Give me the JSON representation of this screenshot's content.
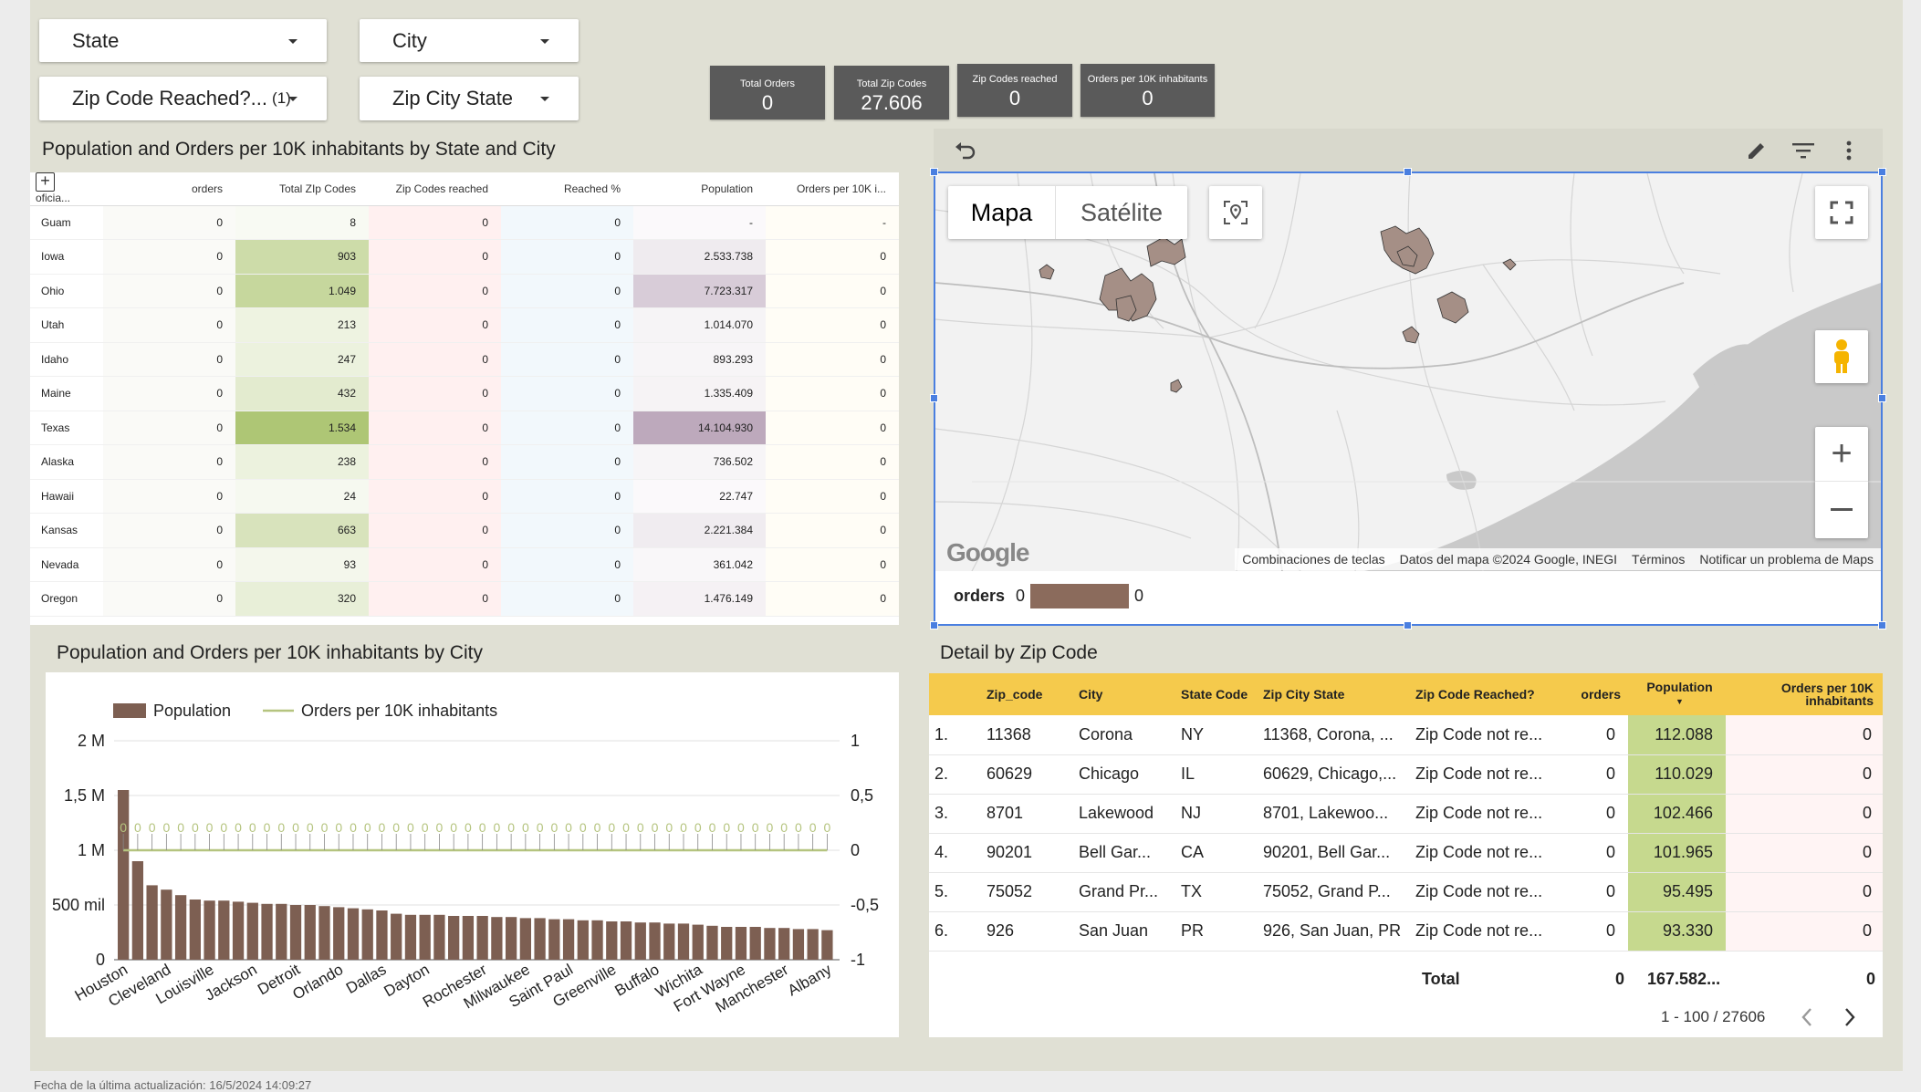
{
  "filters": {
    "state": "State",
    "city": "City",
    "zip_reached": "Zip Code Reached?...",
    "zip_reached_count": "(1)",
    "zip_city_state": "Zip City State"
  },
  "kpis": [
    {
      "label": "Total Orders",
      "value": "0"
    },
    {
      "label": "Total Zip Codes",
      "value": "27.606"
    },
    {
      "label": "Zip Codes reached",
      "value": "0"
    },
    {
      "label": "Orders per 10K inhabitants",
      "value": "0"
    }
  ],
  "state_table": {
    "title": "Population and Orders per 10K inhabitants by State and City",
    "headers": [
      "oficia...",
      "orders",
      "Total ZIp Codes",
      "Zip Codes reached",
      "Reached %",
      "Population",
      "Orders per 10K i..."
    ],
    "rows": [
      {
        "name": "Guam",
        "orders": "0",
        "zips": "8",
        "zips_level": 0.005,
        "reached": "0",
        "pct": "0",
        "pop": "-",
        "pop_level": 0,
        "per10k": "-"
      },
      {
        "name": "Iowa",
        "orders": "0",
        "zips": "903",
        "zips_level": 0.59,
        "reached": "0",
        "pct": "0",
        "pop": "2.533.738",
        "pop_level": 0.18,
        "per10k": "0"
      },
      {
        "name": "Ohio",
        "orders": "0",
        "zips": "1.049",
        "zips_level": 0.68,
        "reached": "0",
        "pct": "0",
        "pop": "7.723.317",
        "pop_level": 0.55,
        "per10k": "0"
      },
      {
        "name": "Utah",
        "orders": "0",
        "zips": "213",
        "zips_level": 0.14,
        "reached": "0",
        "pct": "0",
        "pop": "1.014.070",
        "pop_level": 0.07,
        "per10k": "0"
      },
      {
        "name": "Idaho",
        "orders": "0",
        "zips": "247",
        "zips_level": 0.16,
        "reached": "0",
        "pct": "0",
        "pop": "893.293",
        "pop_level": 0.06,
        "per10k": "0"
      },
      {
        "name": "Maine",
        "orders": "0",
        "zips": "432",
        "zips_level": 0.28,
        "reached": "0",
        "pct": "0",
        "pop": "1.335.409",
        "pop_level": 0.09,
        "per10k": "0"
      },
      {
        "name": "Texas",
        "orders": "0",
        "zips": "1.534",
        "zips_level": 1.0,
        "reached": "0",
        "pct": "0",
        "pop": "14.104.930",
        "pop_level": 1.0,
        "per10k": "0"
      },
      {
        "name": "Alaska",
        "orders": "0",
        "zips": "238",
        "zips_level": 0.16,
        "reached": "0",
        "pct": "0",
        "pop": "736.502",
        "pop_level": 0.05,
        "per10k": "0"
      },
      {
        "name": "Hawaii",
        "orders": "0",
        "zips": "24",
        "zips_level": 0.02,
        "reached": "0",
        "pct": "0",
        "pop": "22.747",
        "pop_level": 0.002,
        "per10k": "0"
      },
      {
        "name": "Kansas",
        "orders": "0",
        "zips": "663",
        "zips_level": 0.43,
        "reached": "0",
        "pct": "0",
        "pop": "2.221.384",
        "pop_level": 0.16,
        "per10k": "0"
      },
      {
        "name": "Nevada",
        "orders": "0",
        "zips": "93",
        "zips_level": 0.06,
        "reached": "0",
        "pct": "0",
        "pop": "361.042",
        "pop_level": 0.03,
        "per10k": "0"
      },
      {
        "name": "Oregon",
        "orders": "0",
        "zips": "320",
        "zips_level": 0.21,
        "reached": "0",
        "pct": "0",
        "pop": "1.476.149",
        "pop_level": 0.1,
        "per10k": "0"
      }
    ]
  },
  "map": {
    "tab_map": "Mapa",
    "tab_satellite": "Satélite",
    "google": "Google",
    "attribution": [
      "Combinaciones de teclas",
      "Datos del mapa ©2024 Google, INEGI",
      "Términos",
      "Notificar un problema de Maps"
    ],
    "legend_label": "orders",
    "legend_min": "0",
    "legend_max": "0",
    "legend_color": "#8b6b5c"
  },
  "city_chart_title": "Population and Orders per 10K inhabitants by City",
  "chart_data": {
    "type": "bar",
    "series": [
      {
        "name": "Population",
        "color": "#7d5f52",
        "values": [
          1550000,
          900000,
          680000,
          640000,
          590000,
          550000,
          540000,
          540000,
          530000,
          520000,
          510000,
          510000,
          500000,
          500000,
          490000,
          480000,
          470000,
          460000,
          450000,
          420000,
          410000,
          410000,
          410000,
          400000,
          400000,
          400000,
          390000,
          390000,
          380000,
          380000,
          370000,
          370000,
          360000,
          360000,
          350000,
          350000,
          340000,
          340000,
          330000,
          330000,
          320000,
          310000,
          300000,
          300000,
          300000,
          290000,
          290000,
          280000,
          280000,
          270000
        ]
      },
      {
        "name": "Orders per 10K inhabitants",
        "color": "#b5c47f",
        "axis": "right",
        "values": [
          0,
          0,
          0,
          0,
          0,
          0,
          0,
          0,
          0,
          0,
          0,
          0,
          0,
          0,
          0,
          0,
          0,
          0,
          0,
          0,
          0,
          0,
          0,
          0,
          0,
          0,
          0,
          0,
          0,
          0,
          0,
          0,
          0,
          0,
          0,
          0,
          0,
          0,
          0,
          0,
          0,
          0,
          0,
          0,
          0,
          0,
          0,
          0,
          0,
          0
        ]
      }
    ],
    "x_tick_labels": [
      "Houston",
      "Cleveland",
      "Louisville",
      "Jackson",
      "Detroit",
      "Orlando",
      "Dallas",
      "Dayton",
      "Rochester",
      "Milwaukee",
      "Saint Paul",
      "Greenville",
      "Buffalo",
      "Wichita",
      "Fort Wayne",
      "Manchester",
      "Albany"
    ],
    "y_ticks": [
      "0",
      "500 mil",
      "1 M",
      "1,5 M",
      "2 M"
    ],
    "y_right_ticks": [
      "-1",
      "-0,5",
      "0",
      "0,5",
      "1"
    ],
    "ylim": [
      0,
      2000000
    ],
    "ylim_right": [
      -1,
      1
    ],
    "data_label": "0",
    "legend": "top-left",
    "grid": true
  },
  "detail": {
    "title": "Detail by Zip Code",
    "headers": [
      "Zip_code",
      "City",
      "State Code",
      "Zip City State",
      "Zip Code Reached?",
      "orders",
      "Population",
      "Orders per 10K inhabitants"
    ],
    "rows": [
      {
        "idx": "1.",
        "zip": "11368",
        "city": "Corona",
        "state": "NY",
        "zcs": "11368, Corona, ...",
        "reached": "Zip Code not re...",
        "orders": "0",
        "pop": "112.088",
        "per10k": "0"
      },
      {
        "idx": "2.",
        "zip": "60629",
        "city": "Chicago",
        "state": "IL",
        "zcs": "60629, Chicago,...",
        "reached": "Zip Code not re...",
        "orders": "0",
        "pop": "110.029",
        "per10k": "0"
      },
      {
        "idx": "3.",
        "zip": "8701",
        "city": "Lakewood",
        "state": "NJ",
        "zcs": "8701, Lakewoo...",
        "reached": "Zip Code not re...",
        "orders": "0",
        "pop": "102.466",
        "per10k": "0"
      },
      {
        "idx": "4.",
        "zip": "90201",
        "city": "Bell Gar...",
        "state": "CA",
        "zcs": "90201, Bell Gar...",
        "reached": "Zip Code not re...",
        "orders": "0",
        "pop": "101.965",
        "per10k": "0"
      },
      {
        "idx": "5.",
        "zip": "75052",
        "city": "Grand Pr...",
        "state": "TX",
        "zcs": "75052, Grand P...",
        "reached": "Zip Code not re...",
        "orders": "0",
        "pop": "95.495",
        "per10k": "0"
      },
      {
        "idx": "6.",
        "zip": "926",
        "city": "San Juan",
        "state": "PR",
        "zcs": "926, San Juan, PR",
        "reached": "Zip Code not re...",
        "orders": "0",
        "pop": "93.330",
        "per10k": "0"
      }
    ],
    "total_label": "Total",
    "total_orders": "0",
    "total_pop": "167.582...",
    "total_per10k": "0",
    "pagination": "1 - 100 / 27606"
  },
  "footer": "Fecha de la última actualización: 16/5/2024 14:09:27",
  "colors": {
    "zips_scale": "#a8c26a",
    "pop_scale": "#a98fa8",
    "reached_bg": "#fff0f0",
    "pct_bg": "#f2f8fc",
    "pop_green": "#c6d98e",
    "header_yellow": "#f5ca4c"
  }
}
